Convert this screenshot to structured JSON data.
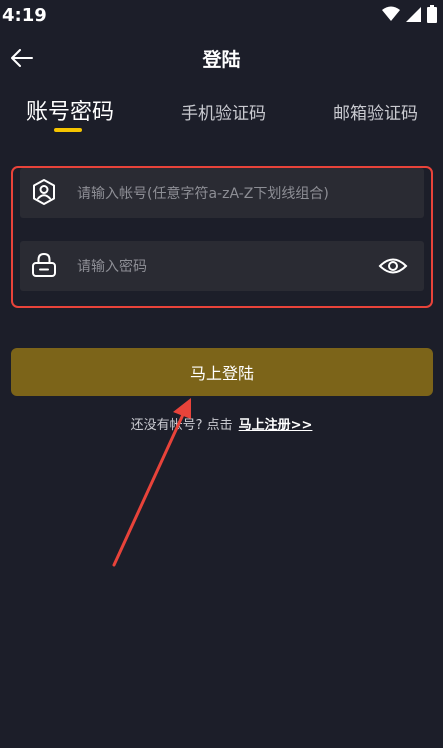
{
  "status_bar": {
    "time": "4:19"
  },
  "header": {
    "title": "登陆"
  },
  "tabs": [
    {
      "label": "账号密码",
      "active": true
    },
    {
      "label": "手机验证码",
      "active": false
    },
    {
      "label": "邮箱验证码",
      "active": false
    }
  ],
  "form": {
    "account_placeholder": "请输入帐号(任意字符a-zA-Z下划线组合)",
    "password_placeholder": "请输入密码"
  },
  "login_button": {
    "label": "马上登陆"
  },
  "register": {
    "prompt": "还没有帐号? 点击",
    "link": "马上注册>>"
  },
  "colors": {
    "background": "#1c1e29",
    "input_bg": "#2a2b33",
    "accent_yellow": "#f5c400",
    "button_bg": "#7c6419",
    "annotation_red": "#e8433a"
  },
  "icons": {
    "back": "arrow-left-icon",
    "user": "user-icon",
    "lock": "lock-icon",
    "eye": "eye-icon",
    "wifi": "wifi-icon",
    "signal": "signal-icon",
    "battery": "battery-icon"
  }
}
